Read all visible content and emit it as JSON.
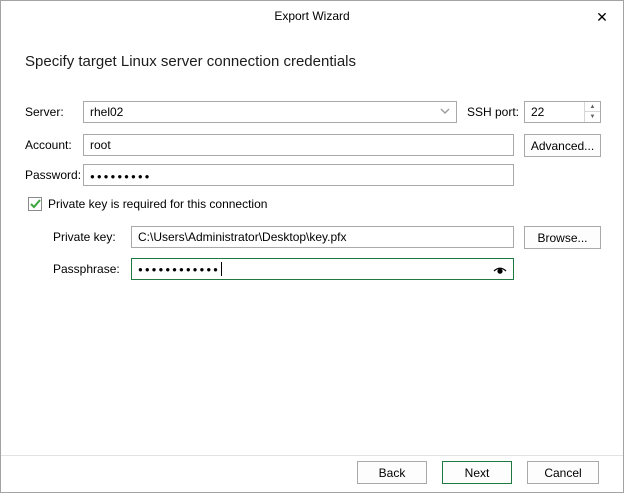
{
  "window": {
    "title": "Export Wizard",
    "close_icon": "✕"
  },
  "heading": "Specify target Linux server connection credentials",
  "form": {
    "server": {
      "label": "Server:",
      "value": "rhel02"
    },
    "ssh_port": {
      "label": "SSH port:",
      "value": "22"
    },
    "account": {
      "label": "Account:",
      "value": "root"
    },
    "advanced_button": "Advanced...",
    "password": {
      "label": "Password:",
      "value": "●●●●●●●●●"
    },
    "private_key_checkbox": {
      "label": "Private key is required for this connection",
      "checked": true
    },
    "private_key": {
      "label": "Private key:",
      "value": "C:\\Users\\Administrator\\Desktop\\key.pfx"
    },
    "browse_button": "Browse...",
    "passphrase": {
      "label": "Passphrase:",
      "value": "●●●●●●●●●●●●"
    }
  },
  "icons": {
    "chevron_down": "⌄",
    "spin_up": "▲",
    "spin_down": "▼"
  },
  "footer": {
    "back": "Back",
    "next": "Next",
    "cancel": "Cancel"
  },
  "colors": {
    "accent_green": "#3ba53c",
    "focus_border_green": "#1e7a40",
    "input_border": "#a9a9a9"
  }
}
